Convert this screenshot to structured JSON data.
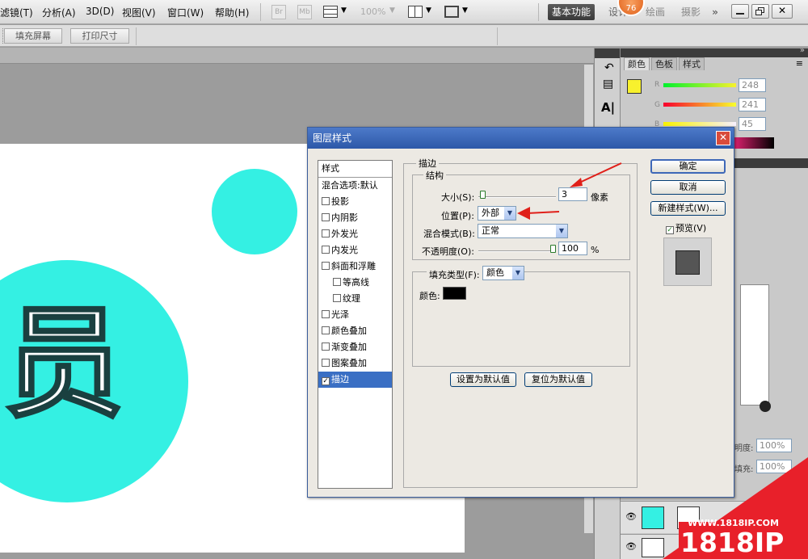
{
  "menubar": {
    "items": [
      "滤镜(T)",
      "分析(A)",
      "3D(D)",
      "视图(V)",
      "窗口(W)",
      "帮助(H)"
    ],
    "zoom": "100%",
    "br_label": "Br",
    "mb_label": "Mb",
    "workspaces": [
      "基本功能",
      "设计",
      "绘画",
      "摄影"
    ],
    "more": "»",
    "badge": "76"
  },
  "optbar": {
    "buttons": [
      "填充屏幕",
      "打印尺寸"
    ]
  },
  "right_panel": {
    "tabs": [
      "颜色",
      "色板",
      "样式"
    ],
    "rgb": [
      {
        "name": "R",
        "value": "248"
      },
      {
        "name": "G",
        "value": "241"
      },
      {
        "name": "B",
        "value": "45"
      }
    ],
    "opacity_label": "明度:",
    "opacity_value": "100%",
    "fill_label": "填充:",
    "fill_value": "100%"
  },
  "canvas": {
    "glyph": "员"
  },
  "dialog": {
    "title": "图层样式",
    "close": "✕",
    "styles_header": "样式",
    "styles": [
      {
        "label": "混合选项:默认",
        "checkbox": false,
        "sub": false,
        "checked": false
      },
      {
        "label": "投影",
        "checkbox": true,
        "sub": false,
        "checked": false
      },
      {
        "label": "内阴影",
        "checkbox": true,
        "sub": false,
        "checked": false
      },
      {
        "label": "外发光",
        "checkbox": true,
        "sub": false,
        "checked": false
      },
      {
        "label": "内发光",
        "checkbox": true,
        "sub": false,
        "checked": false
      },
      {
        "label": "斜面和浮雕",
        "checkbox": true,
        "sub": false,
        "checked": false
      },
      {
        "label": "等高线",
        "checkbox": true,
        "sub": true,
        "checked": false
      },
      {
        "label": "纹理",
        "checkbox": true,
        "sub": true,
        "checked": false
      },
      {
        "label": "光泽",
        "checkbox": true,
        "sub": false,
        "checked": false
      },
      {
        "label": "颜色叠加",
        "checkbox": true,
        "sub": false,
        "checked": false
      },
      {
        "label": "渐变叠加",
        "checkbox": true,
        "sub": false,
        "checked": false
      },
      {
        "label": "图案叠加",
        "checkbox": true,
        "sub": false,
        "checked": false
      },
      {
        "label": "描边",
        "checkbox": true,
        "sub": false,
        "checked": true
      }
    ],
    "stroke_group": "描边",
    "structure_group": "结构",
    "size_label": "大小(S):",
    "size_value": "3",
    "size_unit": "像素",
    "size_level": 0.02,
    "position_label": "位置(P):",
    "position_value": "外部",
    "blend_label": "混合模式(B):",
    "blend_value": "正常",
    "opacity_label": "不透明度(O):",
    "opacity_value": "100",
    "opacity_unit": "%",
    "opacity_level": 1.0,
    "fill_type_label": "填充类型(F):",
    "fill_type_value": "颜色",
    "color_label": "颜色:",
    "stroke_color": "#000000",
    "set_default": "设置为默认值",
    "reset_default": "复位为默认值",
    "ok": "确定",
    "cancel": "取消",
    "new_style": "新建样式(W)...",
    "preview_label": "预览(V)",
    "preview_checked": true
  },
  "watermark": {
    "url": "WWW.1818IP.COM",
    "brand": "1818IP"
  },
  "colors": {
    "cyan": "#34f0e3",
    "foreground_swatch": "#f8f12d",
    "selection_blue": "#3a6fc4",
    "watermark_red": "#e8202a"
  }
}
